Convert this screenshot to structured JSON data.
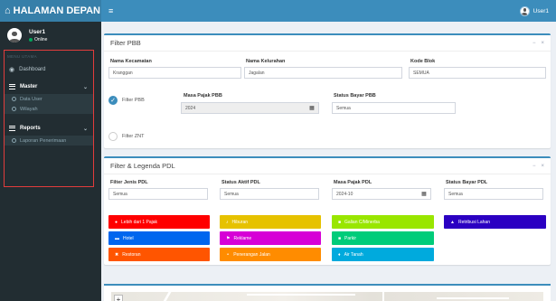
{
  "header": {
    "brand": "HALAMAN DEPAN",
    "user": "User1"
  },
  "sidebar": {
    "user_name": "User1",
    "user_status": "Online",
    "menu_header": "MENU UTAMA",
    "items": [
      {
        "label": "Dashboard",
        "icon": "dashboard-icon"
      },
      {
        "label": "Master",
        "icon": "list-icon",
        "submenu": [
          "Data User",
          "Wilayah"
        ]
      },
      {
        "label": "Reports",
        "icon": "list-icon",
        "submenu": [
          "Laporan Penerimaan"
        ]
      }
    ]
  },
  "filter_pbb": {
    "title": "Filter PBB",
    "kecamatan_label": "Nama Kecamatan",
    "kecamatan_value": "Kranggan",
    "kelurahan_label": "Nama Kelurahan",
    "kelurahan_value": "Jagalan",
    "kode_blok_label": "Kode Blok",
    "kode_blok_value": "SEMUA",
    "filter_pbb_label": "Filter PBB",
    "masa_pajak_label": "Masa Pajak PBB",
    "masa_pajak_value": "2024",
    "status_bayar_label": "Status Bayar PBB",
    "status_bayar_value": "Semua",
    "filter_znt_label": "Filter ZNT"
  },
  "filter_pdl": {
    "title": "Filter & Legenda PDL",
    "jenis_label": "Filter Jenis PDL",
    "jenis_value": "Semua",
    "status_aktif_label": "Status Aktif PDL",
    "status_aktif_value": "Semua",
    "masa_pajak_label": "Masa Pajak PDL",
    "masa_pajak_value": "2024-10",
    "status_bayar_label": "Status Bayar PDL",
    "status_bayar_value": "Semua",
    "legend": [
      {
        "label": "Lebih dari 1 Pajak",
        "color": "#ff0000",
        "icon": "circle-icon"
      },
      {
        "label": "Hiburan",
        "color": "#e6c200",
        "icon": "music-icon"
      },
      {
        "label": "Galian C/Minerba",
        "color": "#99e600",
        "icon": "truck-icon"
      },
      {
        "label": "Retribusi Lahan",
        "color": "#2b00c2",
        "icon": "person-icon"
      },
      {
        "label": "Hotel",
        "color": "#0066ee",
        "icon": "bed-icon"
      },
      {
        "label": "Reklame",
        "color": "#d600d6",
        "icon": "flag-icon"
      },
      {
        "label": "Parkir",
        "color": "#00cc7a",
        "icon": "car-icon"
      },
      {
        "label": "Restoran",
        "color": "#ff5500",
        "icon": "cutlery-icon"
      },
      {
        "label": "Penerangan Jalan",
        "color": "#ff8c00",
        "icon": "bulb-icon"
      },
      {
        "label": "Air Tanah",
        "color": "#00aadd",
        "icon": "drop-icon"
      }
    ]
  },
  "map": {
    "zoom_in": "+"
  }
}
